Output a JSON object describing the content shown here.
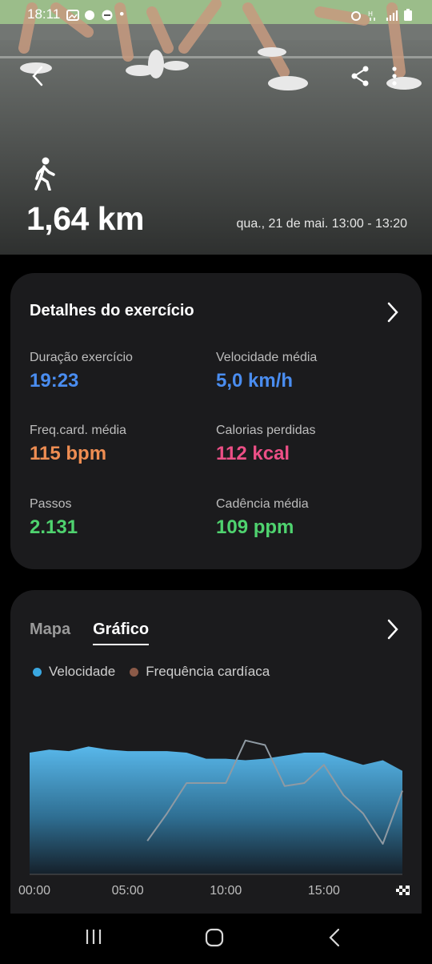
{
  "status_bar": {
    "time": "18:11"
  },
  "hero": {
    "distance": "1,64 km",
    "datetime": "qua., 21 de mai. 13:00 - 13:20",
    "activity_icon": "walking-icon"
  },
  "details": {
    "title": "Detalhes do exercício",
    "metrics": [
      {
        "label": "Duração exercício",
        "value": "19:23"
      },
      {
        "label": "Velocidade média",
        "value": "5,0 km/h"
      },
      {
        "label": "Freq.card. média",
        "value": "115 bpm"
      },
      {
        "label": "Calorias perdidas",
        "value": "112 kcal"
      },
      {
        "label": "Passos",
        "value": "2.131"
      },
      {
        "label": "Cadência média",
        "value": "109 ppm"
      }
    ]
  },
  "graph": {
    "tabs": [
      "Mapa",
      "Gráfico"
    ],
    "active_tab": "Gráfico",
    "legend": [
      {
        "name": "Velocidade",
        "color": "#3aa7e0"
      },
      {
        "name": "Frequência cardíaca",
        "color": "#8b5a48"
      }
    ],
    "x_ticks": [
      "00:00",
      "05:00",
      "10:00",
      "15:00"
    ]
  },
  "chart_data": {
    "type": "area",
    "x": [
      0,
      1,
      2,
      3,
      4,
      5,
      6,
      7,
      8,
      9,
      10,
      11,
      12,
      13,
      14,
      15,
      16,
      17,
      18,
      19
    ],
    "series": [
      {
        "name": "Velocidade",
        "values": [
          0.8,
          0.82,
          0.81,
          0.84,
          0.82,
          0.81,
          0.81,
          0.81,
          0.8,
          0.76,
          0.76,
          0.75,
          0.76,
          0.78,
          0.8,
          0.8,
          0.76,
          0.72,
          0.75,
          0.68
        ]
      },
      {
        "name": "Frequência cardíaca",
        "values": [
          null,
          null,
          null,
          null,
          null,
          null,
          0.22,
          0.4,
          0.6,
          0.6,
          0.6,
          0.88,
          0.85,
          0.58,
          0.6,
          0.72,
          0.52,
          0.4,
          0.2,
          0.55
        ]
      }
    ],
    "xlabel": "",
    "ylabel": "",
    "grid": false
  },
  "nav": {
    "recents": "recents-icon",
    "home": "home-icon",
    "back": "back-icon"
  }
}
